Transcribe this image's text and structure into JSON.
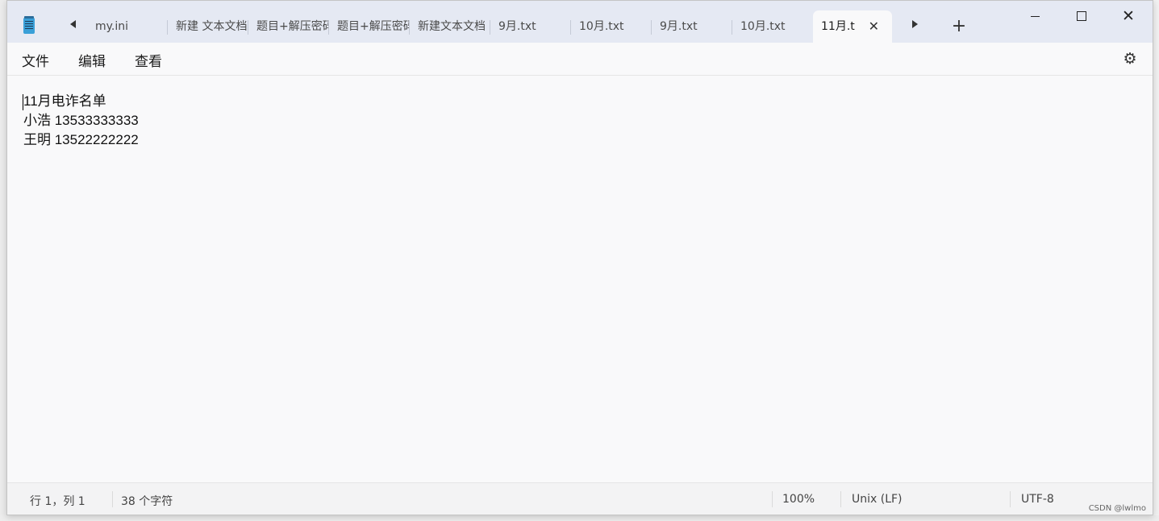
{
  "window": {
    "tabs": [
      {
        "label": "my.ini",
        "active": false
      },
      {
        "label": "新建 文本文档",
        "active": false
      },
      {
        "label": "题目+解压密码",
        "active": false
      },
      {
        "label": "题目+解压密码",
        "active": false
      },
      {
        "label": "新建文本文档",
        "active": false
      },
      {
        "label": "9月.txt",
        "active": false
      },
      {
        "label": "10月.txt",
        "active": false
      },
      {
        "label": "9月.txt",
        "active": false
      },
      {
        "label": "10月.txt",
        "active": false
      },
      {
        "label": "11月.t",
        "active": true
      }
    ],
    "new_tab_label": "+",
    "close_tab_glyph": "✕",
    "close_window_glyph": "✕"
  },
  "menu": {
    "file": "文件",
    "edit": "编辑",
    "view": "查看",
    "settings_icon": "gear-icon"
  },
  "editor": {
    "lines": [
      "11月电诈名单",
      "小浩 13533333333",
      "王明 13522222222"
    ]
  },
  "status": {
    "position": "行 1，列 1",
    "char_count": "38 个字符",
    "zoom": "100%",
    "line_ending": "Unix (LF)",
    "encoding": "UTF-8"
  },
  "watermark": "CSDN @lwlmo",
  "colors": {
    "titlebar_bg": "#e5e9f3",
    "editor_bg": "#f9f9fa",
    "statusbar_bg": "#f3f3f4",
    "app_icon_accent": "#3aa0d8"
  }
}
